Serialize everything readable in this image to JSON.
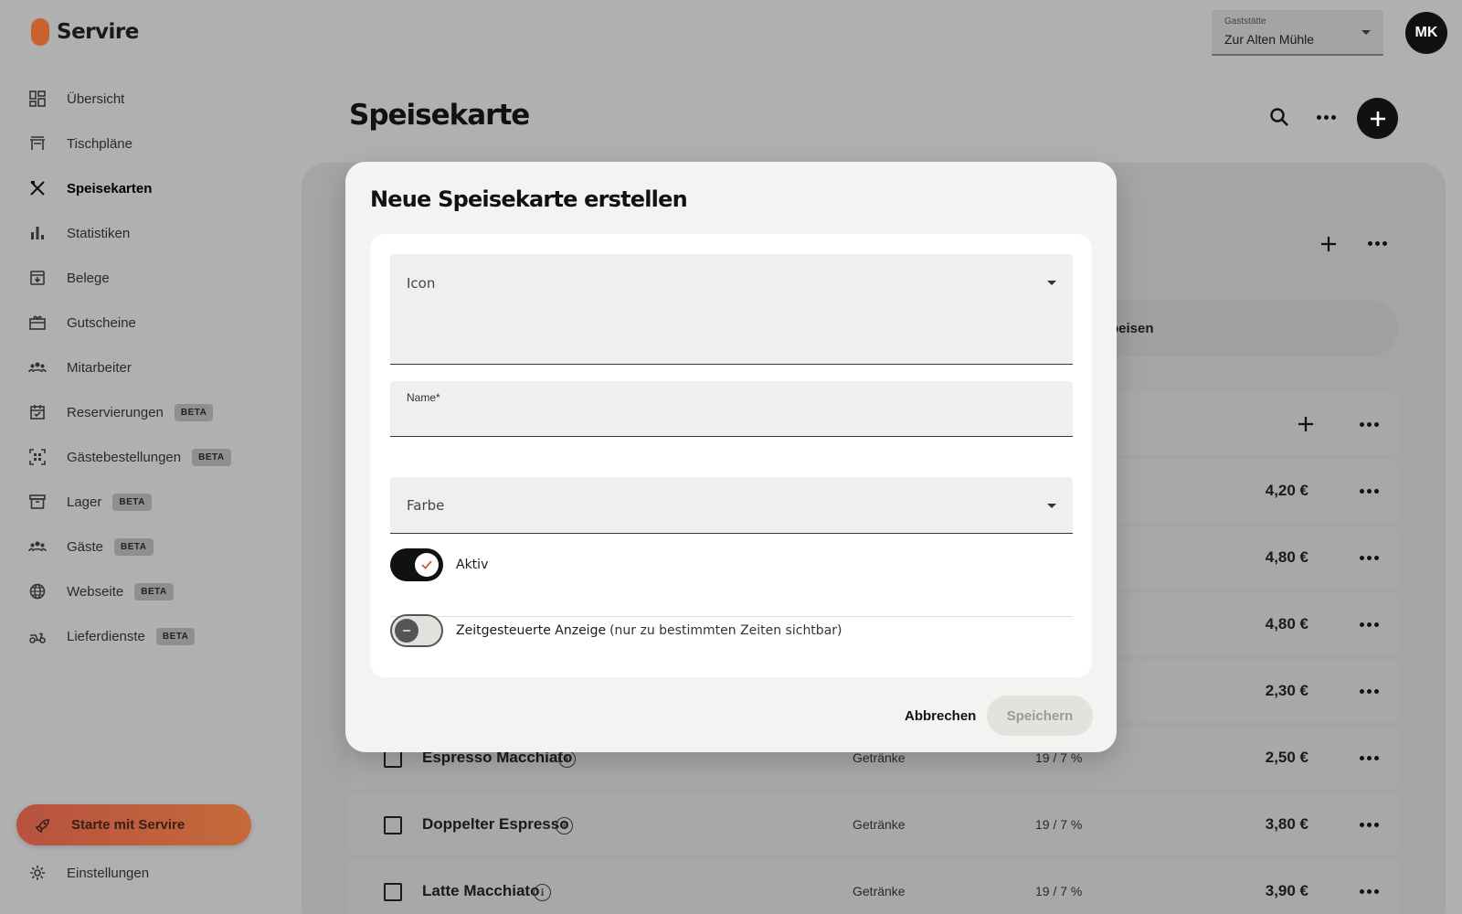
{
  "app": {
    "name": "Servire"
  },
  "sidebar": {
    "items": [
      {
        "label": "Übersicht",
        "icon": "dashboard-icon"
      },
      {
        "label": "Tischpläne",
        "icon": "table-icon"
      },
      {
        "label": "Speisekarten",
        "icon": "cutlery-icon",
        "active": true
      },
      {
        "label": "Statistiken",
        "icon": "bar-chart-icon"
      },
      {
        "label": "Belege",
        "icon": "receipt-icon"
      },
      {
        "label": "Gutscheine",
        "icon": "gift-card-icon"
      },
      {
        "label": "Mitarbeiter",
        "icon": "staff-icon"
      },
      {
        "label": "Reservierungen",
        "icon": "calendar-icon",
        "badge": "BETA"
      },
      {
        "label": "Gästebestellungen",
        "icon": "qr-code-icon",
        "badge": "BETA"
      },
      {
        "label": "Lager",
        "icon": "archive-icon",
        "badge": "BETA"
      },
      {
        "label": "Gäste",
        "icon": "guests-icon",
        "badge": "BETA"
      },
      {
        "label": "Webseite",
        "icon": "globe-icon",
        "badge": "BETA"
      },
      {
        "label": "Lieferdienste",
        "icon": "scooter-icon",
        "badge": "BETA"
      }
    ],
    "cta": {
      "label": "Starte mit Servire",
      "icon": "rocket-icon"
    },
    "settings": {
      "label": "Einstellungen",
      "icon": "gear-icon"
    }
  },
  "header": {
    "venue": {
      "label": "Gaststätte",
      "value": "Zur Alten Mühle"
    },
    "avatar": "MK"
  },
  "main": {
    "title": "Speisekarte",
    "pill_text": "peisen",
    "rows": [
      {
        "price": "4,20 €"
      },
      {
        "price": "4,80 €"
      },
      {
        "price": "4,80 €"
      },
      {
        "price": "2,30 €"
      },
      {
        "name": "Espresso Macchiato",
        "category": "Getränke",
        "tax": "19 / 7 %",
        "price": "2,50 €"
      },
      {
        "name": "Doppelter Espresso",
        "category": "Getränke",
        "tax": "19 / 7 %",
        "price": "3,80 €"
      },
      {
        "name": "Latte Macchiato",
        "category": "Getränke",
        "tax": "19 / 7 %",
        "price": "3,90 €"
      }
    ]
  },
  "modal": {
    "title": "Neue Speisekarte erstellen",
    "icon_field": {
      "label": "Icon"
    },
    "name_field": {
      "label": "Name*",
      "value": ""
    },
    "color_field": {
      "label": "Farbe"
    },
    "active_toggle": {
      "label": "Aktiv",
      "on": true
    },
    "timed_toggle": {
      "label": "Zeitgesteuerte Anzeige",
      "sub": "(nur zu bestimmten Zeiten sichtbar)",
      "on": false
    },
    "cancel_label": "Abbrechen",
    "save_label": "Speichern"
  },
  "colors": {
    "brand": "#c8622e",
    "overlay": "#b0b0b0",
    "modal_bg": "#f4f3f1",
    "dark": "#111111"
  }
}
